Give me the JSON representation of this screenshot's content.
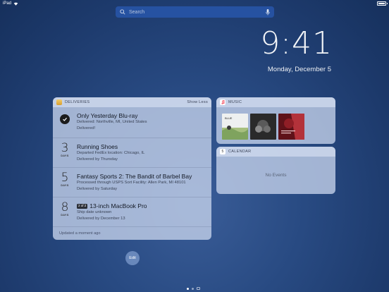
{
  "status_bar": {
    "device": "iPad"
  },
  "search": {
    "placeholder": "Search"
  },
  "clock": {
    "time": "9:41",
    "date": "Monday, December 5"
  },
  "deliveries": {
    "header": "DELIVERIES",
    "show_less": "Show Less",
    "items": [
      {
        "days": "",
        "status_icon": "checkmark-icon",
        "title": "Only Yesterday Blu-ray",
        "line1": "Delivered: Northville, MI, United States",
        "line2": "Delivered!"
      },
      {
        "days": "3",
        "days_label": "DAYS",
        "title": "Running Shoes",
        "line1": "Departed FedEx location: Chicago, IL",
        "line2": "Delivered by Thursday"
      },
      {
        "days": "5",
        "days_label": "DAYS",
        "title": "Fantasy Sports 2: The Bandit of Barbel Bay",
        "line1": "Processed through USPS Sort Facility: Allen Park, MI 48101",
        "line2": "Delivered by Saturday"
      },
      {
        "days": "8",
        "days_label": "DAYS",
        "badge": "2 of 2",
        "title": "13-inch MacBook Pro",
        "line1": "Ship date unknown",
        "line2": "Delivered by December 13"
      }
    ],
    "updated": "Updated a moment ago",
    "accent": "#e8b54a"
  },
  "music": {
    "header": "MUSIC",
    "albums": [
      {
        "name": "album-1",
        "colors": [
          "#e9ecef",
          "#9ab87a"
        ]
      },
      {
        "name": "album-2",
        "colors": [
          "#2b2b2b",
          "#7a7a7a"
        ]
      },
      {
        "name": "album-3",
        "colors": [
          "#6e1720",
          "#c13a3f"
        ]
      }
    ]
  },
  "calendar": {
    "header": "CALENDAR",
    "empty": "No Events"
  },
  "edit_label": "Edit"
}
